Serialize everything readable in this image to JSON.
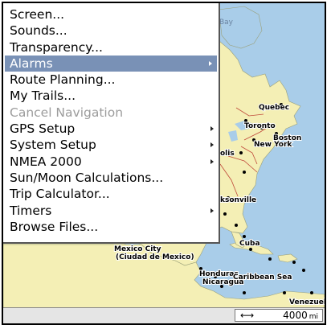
{
  "menu": {
    "items": [
      {
        "label": "Screen..."
      },
      {
        "label": "Sounds..."
      },
      {
        "label": "Transparency..."
      },
      {
        "label": "Alarms",
        "selected": true,
        "submenu": true
      },
      {
        "label": "Route Planning..."
      },
      {
        "label": "My Trails..."
      },
      {
        "label": "Cancel Navigation",
        "disabled": true
      },
      {
        "label": "GPS Setup",
        "submenu": true
      },
      {
        "label": "System Setup",
        "submenu": true
      },
      {
        "label": "NMEA 2000",
        "submenu": true
      },
      {
        "label": "Sun/Moon Calculations..."
      },
      {
        "label": "Trip Calculator..."
      },
      {
        "label": "Timers",
        "submenu": true
      },
      {
        "label": "Browse Files..."
      }
    ]
  },
  "map": {
    "labels": {
      "hudson_bay": "Hudson Bay",
      "quebec": "Quebec",
      "toronto": "Toronto",
      "boston": "Boston",
      "new_york": "New York",
      "indianapolis_frag": "olis",
      "jacksonville_frag": "ksonville",
      "mexico_city_1": "Mexico City",
      "mexico_city_2": "(Ciudad de Mexico)",
      "cuba": "Cuba",
      "honduras": "Honduras",
      "nicaragua": "Nicaragua",
      "caribbean_sea": "Caribbean Sea",
      "venezuela": "Venezuela"
    },
    "colors": {
      "water": "#a9cde9",
      "land": "#f4efb5",
      "menu_highlight": "#7991b6"
    }
  },
  "status_bar": {
    "scale_icon": "horizontal-double-arrow-icon",
    "scale_value": "4000",
    "scale_unit": "mi"
  }
}
